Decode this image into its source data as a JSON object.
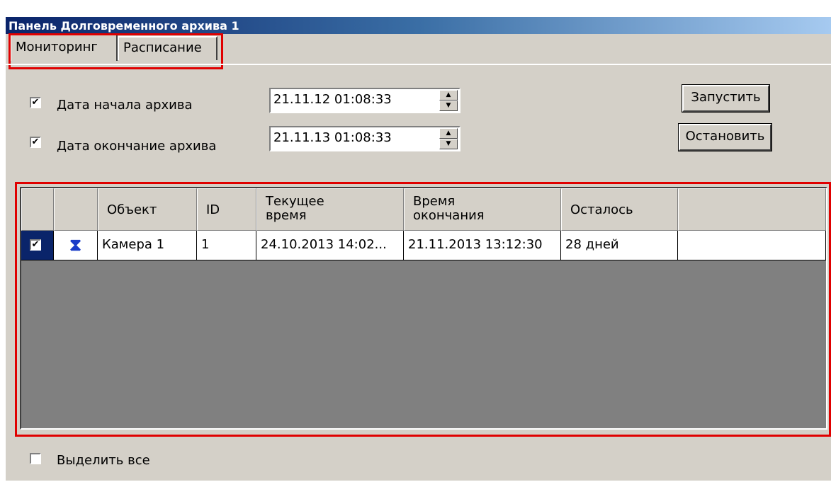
{
  "window": {
    "title": "Панель Долговременного архива 1"
  },
  "tabs": [
    {
      "label": "Мониторинг",
      "active": true
    },
    {
      "label": "Расписание",
      "active": false
    }
  ],
  "archive_start": {
    "checked": true,
    "check_mark": "✔",
    "label": "Дата начала архива",
    "value": "21.11.12 01:08:33"
  },
  "archive_end": {
    "checked": true,
    "check_mark": "✔",
    "label": "Дата окончание архива",
    "value": "21.11.13 01:08:33"
  },
  "buttons": {
    "start": "Запустить",
    "stop": "Остановить"
  },
  "spin": {
    "up": "▲",
    "down": "▼"
  },
  "table": {
    "columns": [
      {
        "line1": "",
        "line2": ""
      },
      {
        "line1": "",
        "line2": ""
      },
      {
        "line1": "Объект",
        "line2": ""
      },
      {
        "line1": "ID",
        "line2": ""
      },
      {
        "line1": "Текущее",
        "line2": "время"
      },
      {
        "line1": "Время",
        "line2": "окончания"
      },
      {
        "line1": "Осталось",
        "line2": ""
      },
      {
        "line1": "",
        "line2": ""
      }
    ],
    "rows": [
      {
        "checked": true,
        "check_mark": "✔",
        "status_icon": "hourglass-icon",
        "status_glyph": "⧗",
        "object": "Камера 1",
        "id": "1",
        "current_time": "24.10.2013 14:02...",
        "end_time": "21.11.2013 13:12:30",
        "remaining": "28 дней"
      }
    ]
  },
  "select_all": {
    "checked": false,
    "label": "Выделить все"
  },
  "colors": {
    "highlight_box": "#e00000",
    "titlebar_start": "#0a246a",
    "titlebar_end": "#a6caf0",
    "window_bg": "#d4d0c8",
    "grid_empty_bg": "#808080",
    "row_select_bg": "#0a246a",
    "icon_accent": "#1a3cc8"
  }
}
